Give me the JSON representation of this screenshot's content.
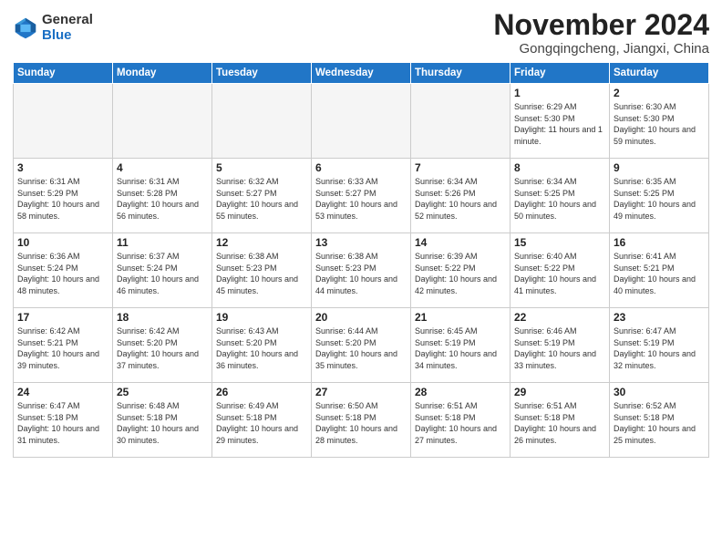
{
  "logo": {
    "general": "General",
    "blue": "Blue"
  },
  "header": {
    "month": "November 2024",
    "location": "Gongqingcheng, Jiangxi, China"
  },
  "weekdays": [
    "Sunday",
    "Monday",
    "Tuesday",
    "Wednesday",
    "Thursday",
    "Friday",
    "Saturday"
  ],
  "weeks": [
    [
      {
        "day": "",
        "info": ""
      },
      {
        "day": "",
        "info": ""
      },
      {
        "day": "",
        "info": ""
      },
      {
        "day": "",
        "info": ""
      },
      {
        "day": "",
        "info": ""
      },
      {
        "day": "1",
        "info": "Sunrise: 6:29 AM\nSunset: 5:30 PM\nDaylight: 11 hours and 1 minute."
      },
      {
        "day": "2",
        "info": "Sunrise: 6:30 AM\nSunset: 5:30 PM\nDaylight: 10 hours and 59 minutes."
      }
    ],
    [
      {
        "day": "3",
        "info": "Sunrise: 6:31 AM\nSunset: 5:29 PM\nDaylight: 10 hours and 58 minutes."
      },
      {
        "day": "4",
        "info": "Sunrise: 6:31 AM\nSunset: 5:28 PM\nDaylight: 10 hours and 56 minutes."
      },
      {
        "day": "5",
        "info": "Sunrise: 6:32 AM\nSunset: 5:27 PM\nDaylight: 10 hours and 55 minutes."
      },
      {
        "day": "6",
        "info": "Sunrise: 6:33 AM\nSunset: 5:27 PM\nDaylight: 10 hours and 53 minutes."
      },
      {
        "day": "7",
        "info": "Sunrise: 6:34 AM\nSunset: 5:26 PM\nDaylight: 10 hours and 52 minutes."
      },
      {
        "day": "8",
        "info": "Sunrise: 6:34 AM\nSunset: 5:25 PM\nDaylight: 10 hours and 50 minutes."
      },
      {
        "day": "9",
        "info": "Sunrise: 6:35 AM\nSunset: 5:25 PM\nDaylight: 10 hours and 49 minutes."
      }
    ],
    [
      {
        "day": "10",
        "info": "Sunrise: 6:36 AM\nSunset: 5:24 PM\nDaylight: 10 hours and 48 minutes."
      },
      {
        "day": "11",
        "info": "Sunrise: 6:37 AM\nSunset: 5:24 PM\nDaylight: 10 hours and 46 minutes."
      },
      {
        "day": "12",
        "info": "Sunrise: 6:38 AM\nSunset: 5:23 PM\nDaylight: 10 hours and 45 minutes."
      },
      {
        "day": "13",
        "info": "Sunrise: 6:38 AM\nSunset: 5:23 PM\nDaylight: 10 hours and 44 minutes."
      },
      {
        "day": "14",
        "info": "Sunrise: 6:39 AM\nSunset: 5:22 PM\nDaylight: 10 hours and 42 minutes."
      },
      {
        "day": "15",
        "info": "Sunrise: 6:40 AM\nSunset: 5:22 PM\nDaylight: 10 hours and 41 minutes."
      },
      {
        "day": "16",
        "info": "Sunrise: 6:41 AM\nSunset: 5:21 PM\nDaylight: 10 hours and 40 minutes."
      }
    ],
    [
      {
        "day": "17",
        "info": "Sunrise: 6:42 AM\nSunset: 5:21 PM\nDaylight: 10 hours and 39 minutes."
      },
      {
        "day": "18",
        "info": "Sunrise: 6:42 AM\nSunset: 5:20 PM\nDaylight: 10 hours and 37 minutes."
      },
      {
        "day": "19",
        "info": "Sunrise: 6:43 AM\nSunset: 5:20 PM\nDaylight: 10 hours and 36 minutes."
      },
      {
        "day": "20",
        "info": "Sunrise: 6:44 AM\nSunset: 5:20 PM\nDaylight: 10 hours and 35 minutes."
      },
      {
        "day": "21",
        "info": "Sunrise: 6:45 AM\nSunset: 5:19 PM\nDaylight: 10 hours and 34 minutes."
      },
      {
        "day": "22",
        "info": "Sunrise: 6:46 AM\nSunset: 5:19 PM\nDaylight: 10 hours and 33 minutes."
      },
      {
        "day": "23",
        "info": "Sunrise: 6:47 AM\nSunset: 5:19 PM\nDaylight: 10 hours and 32 minutes."
      }
    ],
    [
      {
        "day": "24",
        "info": "Sunrise: 6:47 AM\nSunset: 5:18 PM\nDaylight: 10 hours and 31 minutes."
      },
      {
        "day": "25",
        "info": "Sunrise: 6:48 AM\nSunset: 5:18 PM\nDaylight: 10 hours and 30 minutes."
      },
      {
        "day": "26",
        "info": "Sunrise: 6:49 AM\nSunset: 5:18 PM\nDaylight: 10 hours and 29 minutes."
      },
      {
        "day": "27",
        "info": "Sunrise: 6:50 AM\nSunset: 5:18 PM\nDaylight: 10 hours and 28 minutes."
      },
      {
        "day": "28",
        "info": "Sunrise: 6:51 AM\nSunset: 5:18 PM\nDaylight: 10 hours and 27 minutes."
      },
      {
        "day": "29",
        "info": "Sunrise: 6:51 AM\nSunset: 5:18 PM\nDaylight: 10 hours and 26 minutes."
      },
      {
        "day": "30",
        "info": "Sunrise: 6:52 AM\nSunset: 5:18 PM\nDaylight: 10 hours and 25 minutes."
      }
    ]
  ]
}
